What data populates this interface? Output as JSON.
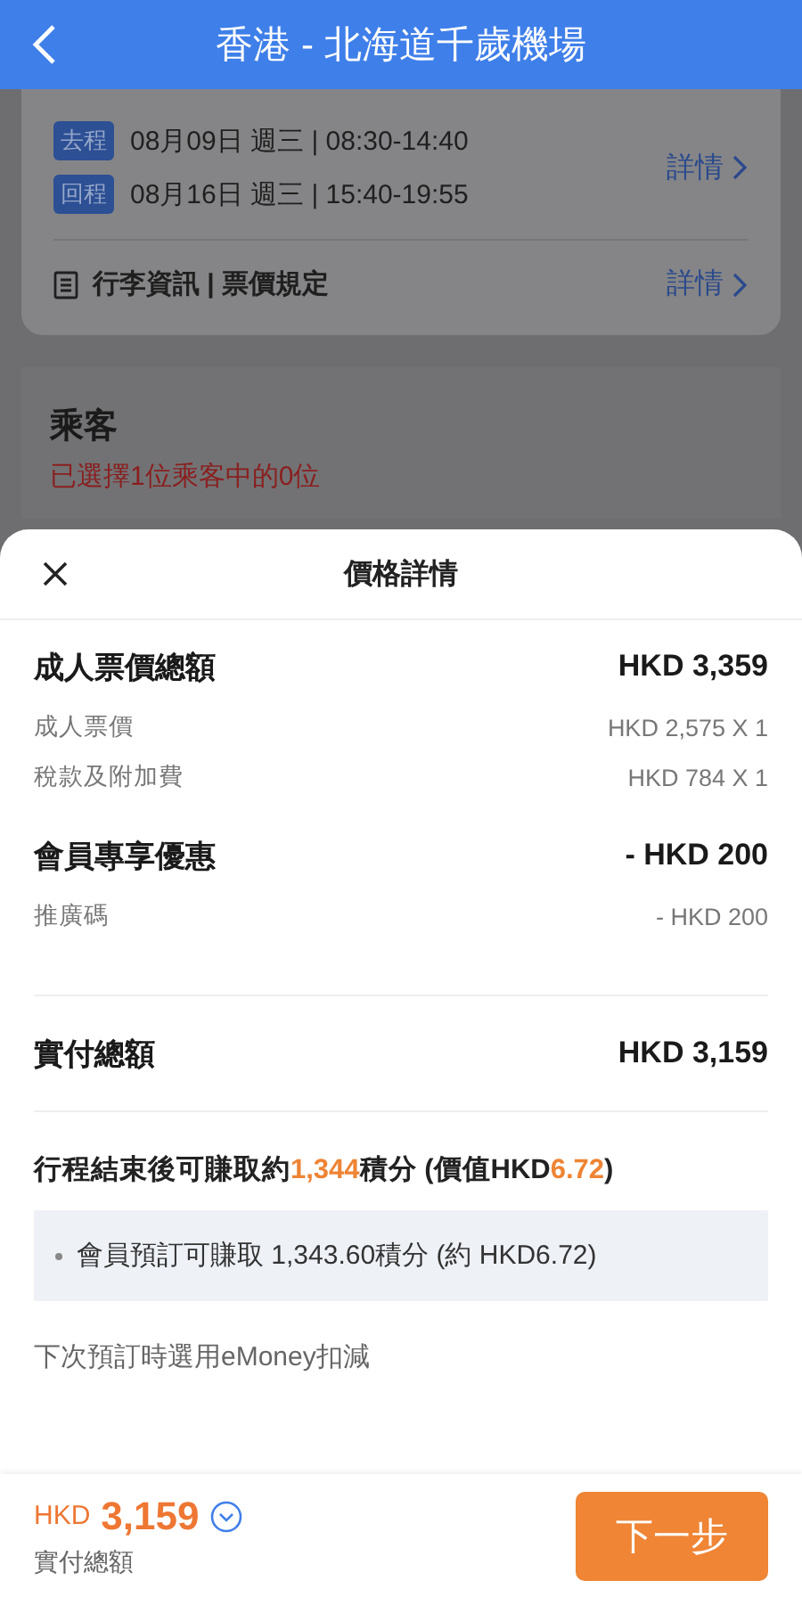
{
  "header": {
    "title": "香港 - 北海道千歲機場"
  },
  "trip": {
    "legs": [
      {
        "tag": "去程",
        "text": "08月09日 週三 | 08:30-14:40"
      },
      {
        "tag": "回程",
        "text": "08月16日 週三 | 15:40-19:55"
      }
    ],
    "details_link": "詳情",
    "rules": {
      "text": "行李資訊 | 票價規定",
      "link": "詳情"
    }
  },
  "passengers": {
    "title": "乘客",
    "status": "已選擇1位乘客中的0位"
  },
  "sheet": {
    "title": "價格詳情",
    "groups": [
      {
        "label": "成人票價總額",
        "amount": "HKD 3,359",
        "items": [
          {
            "label": "成人票價",
            "amount": "HKD 2,575 X 1"
          },
          {
            "label": "稅款及附加費",
            "amount": "HKD 784 X 1"
          }
        ]
      },
      {
        "label": "會員專享優惠",
        "amount": "- HKD 200",
        "items": [
          {
            "label": "推廣碼",
            "amount": "- HKD 200"
          }
        ]
      }
    ],
    "total": {
      "label": "實付總額",
      "amount": "HKD 3,159"
    },
    "earn_parts": [
      {
        "text": "行程結束後可賺取約",
        "highlight": false
      },
      {
        "text": "1,344",
        "highlight": true
      },
      {
        "text": "積分 (價值HKD",
        "highlight": false
      },
      {
        "text": "6.72",
        "highlight": true
      },
      {
        "text": ")",
        "highlight": false
      }
    ],
    "earn_items": [
      "會員預訂可賺取 1,343.60積分 (約 HKD6.72)"
    ],
    "note": "下次預訂時選用eMoney扣減"
  },
  "footer": {
    "currency": "HKD",
    "amount": "3,159",
    "label": "實付總額",
    "button": "下一步"
  }
}
